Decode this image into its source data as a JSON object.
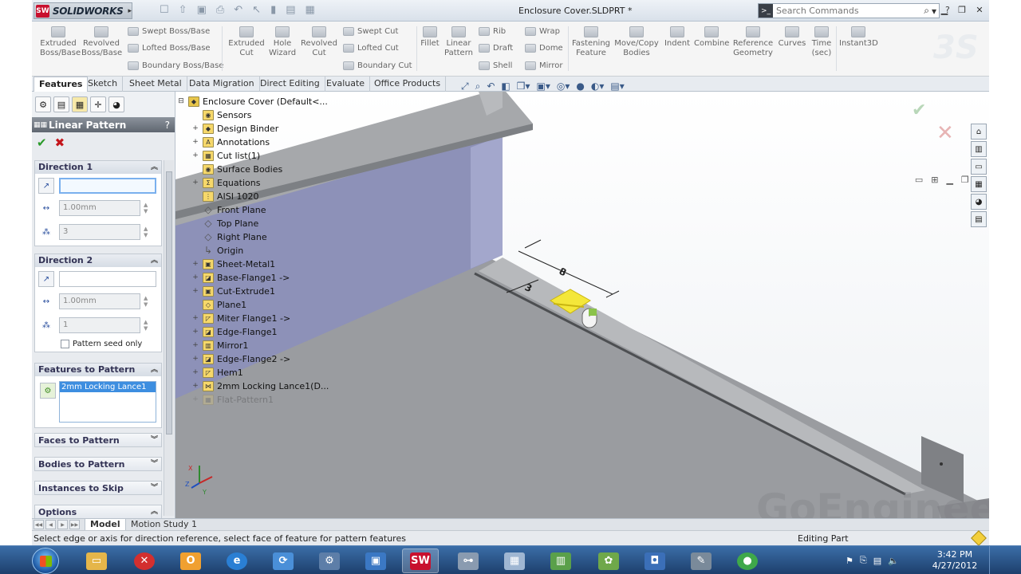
{
  "app": {
    "logo_text": "SOLIDWORKS",
    "logo_badge": "SW",
    "doc_title": "Enclosure Cover.SLDPRT *",
    "search_placeholder": "Search Commands",
    "help": "?"
  },
  "ribbon": {
    "buttons": [
      {
        "label": "Extruded\nBoss/Base"
      },
      {
        "label": "Revolved\nBoss/Base"
      },
      {
        "label": "Extruded\nCut"
      },
      {
        "label": "Hole\nWizard"
      },
      {
        "label": "Revolved\nCut"
      },
      {
        "label": "Fillet"
      },
      {
        "label": "Linear\nPattern"
      },
      {
        "label": "Fastening\nFeature"
      },
      {
        "label": "Move/Copy\nBodies"
      },
      {
        "label": "Indent"
      },
      {
        "label": "Combine"
      },
      {
        "label": "Reference\nGeometry"
      },
      {
        "label": "Curves"
      },
      {
        "label": "Time\n(sec)"
      },
      {
        "label": "Instant3D"
      }
    ],
    "small": {
      "swept_boss": "Swept Boss/Base",
      "lofted_boss": "Lofted Boss/Base",
      "boundary_boss": "Boundary Boss/Base",
      "swept_cut": "Swept Cut",
      "lofted_cut": "Lofted Cut",
      "boundary_cut": "Boundary Cut",
      "rib": "Rib",
      "draft": "Draft",
      "shell": "Shell",
      "wrap": "Wrap",
      "dome": "Dome",
      "mirror": "Mirror"
    }
  },
  "tabs": [
    "Features",
    "Sketch",
    "Sheet Metal",
    "Data Migration",
    "Direct Editing",
    "Evaluate",
    "Office Products"
  ],
  "property_manager": {
    "title": "Linear Pattern",
    "help": "?",
    "direction1": {
      "header": "Direction 1",
      "reference": "",
      "spacing": "1.00mm",
      "instances": "3"
    },
    "direction2": {
      "header": "Direction 2",
      "reference": "",
      "spacing": "1.00mm",
      "instances": "1",
      "seed_only": "Pattern seed only"
    },
    "features_to_pattern": {
      "header": "Features to Pattern",
      "selected": "2mm Locking Lance1"
    },
    "collapsed": [
      "Faces to Pattern",
      "Bodies to Pattern",
      "Instances to Skip",
      "Options"
    ]
  },
  "tree": {
    "root": "Enclosure Cover  (Default<...",
    "items": [
      {
        "label": "Sensors",
        "expand": ""
      },
      {
        "label": "Design Binder",
        "expand": "+"
      },
      {
        "label": "Annotations",
        "expand": "+"
      },
      {
        "label": "Cut list(1)",
        "expand": "+"
      },
      {
        "label": "Surface Bodies",
        "expand": ""
      },
      {
        "label": "Equations",
        "expand": "+"
      },
      {
        "label": "AISI 1020",
        "expand": ""
      },
      {
        "label": "Front Plane",
        "expand": ""
      },
      {
        "label": "Top Plane",
        "expand": ""
      },
      {
        "label": "Right Plane",
        "expand": ""
      },
      {
        "label": "Origin",
        "expand": ""
      },
      {
        "label": "Sheet-Metal1",
        "expand": "+"
      },
      {
        "label": "Base-Flange1 ->",
        "expand": "+"
      },
      {
        "label": "Cut-Extrude1",
        "expand": "+"
      },
      {
        "label": "Plane1",
        "expand": ""
      },
      {
        "label": "Miter Flange1 ->",
        "expand": "+"
      },
      {
        "label": "Edge-Flange1",
        "expand": "+"
      },
      {
        "label": "Mirror1",
        "expand": "+"
      },
      {
        "label": "Edge-Flange2 ->",
        "expand": "+"
      },
      {
        "label": "Hem1",
        "expand": "+"
      },
      {
        "label": "2mm Locking Lance1(D...",
        "expand": "+"
      },
      {
        "label": "Flat-Pattern1",
        "expand": "+"
      }
    ]
  },
  "bottom_tabs": [
    "Model",
    "Motion Study 1"
  ],
  "status": {
    "message": "Select edge or axis for direction reference, select face of feature for pattern features",
    "mode": "Editing Part"
  },
  "watermark": "GoEngineer",
  "taskbar": {
    "time": "3:42 PM",
    "date": "4/27/2012"
  },
  "colors": {
    "pm_header": "#6b727b",
    "ok_green": "#2a9a2a",
    "cancel_red": "#c4161c",
    "selection_blue": "#3d8ee0",
    "part_face": "#9a9ca0",
    "part_wall": "#8d91b8",
    "lance_highlight": "#f4e73a"
  }
}
